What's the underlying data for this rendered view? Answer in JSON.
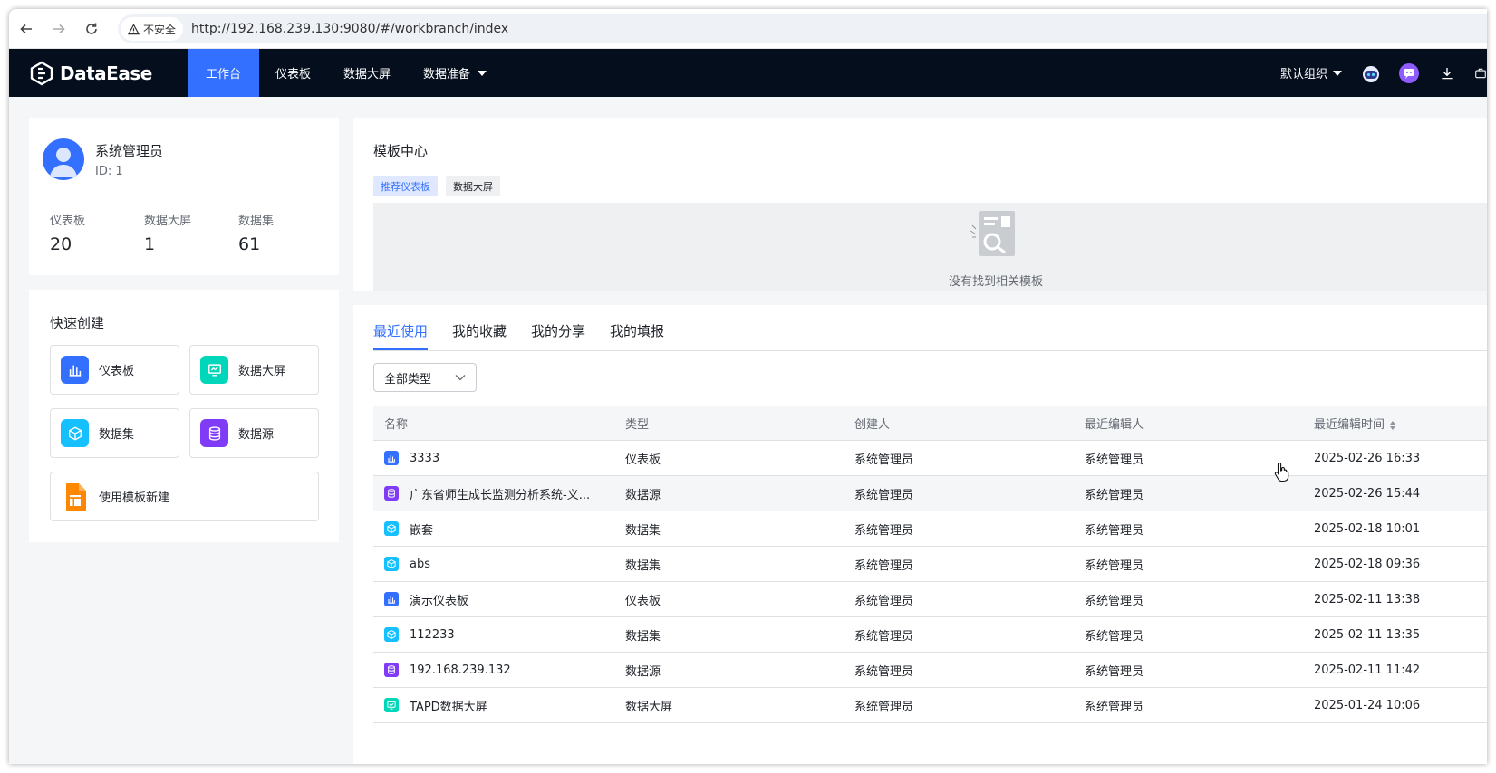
{
  "browser": {
    "security_label": "不安全",
    "url": "http://192.168.239.130:9080/#/workbranch/index"
  },
  "app": {
    "name": "DataEase",
    "nav": [
      {
        "label": "工作台",
        "active": true
      },
      {
        "label": "仪表板"
      },
      {
        "label": "数据大屏"
      },
      {
        "label": "数据准备",
        "dropdown": true
      }
    ],
    "org_label": "默认组织"
  },
  "user": {
    "name": "系统管理员",
    "id_label": "ID: 1",
    "stats": [
      {
        "label": "仪表板",
        "value": "20"
      },
      {
        "label": "数据大屏",
        "value": "1"
      },
      {
        "label": "数据集",
        "value": "61"
      }
    ]
  },
  "quick_create": {
    "title": "快速创建",
    "buttons": [
      {
        "label": "仪表板",
        "icon": "dashboard-icon",
        "color": "#3370ff"
      },
      {
        "label": "数据大屏",
        "icon": "screen-icon",
        "color": "#00d6b9"
      },
      {
        "label": "数据集",
        "icon": "dataset-icon",
        "color": "#16c0ff"
      },
      {
        "label": "数据源",
        "icon": "datasource-icon",
        "color": "#7f3bf5"
      },
      {
        "label": "使用模板新建",
        "icon": "template-icon",
        "color": "#ff8800"
      }
    ]
  },
  "template_center": {
    "title": "模板中心",
    "tags": [
      "推荐仪表板",
      "数据大屏"
    ],
    "empty_text": "没有找到相关模板"
  },
  "recent": {
    "tabs": [
      "最近使用",
      "我的收藏",
      "我的分享",
      "我的填报"
    ],
    "filter_label": "全部类型",
    "columns": [
      "名称",
      "类型",
      "创建人",
      "最近编辑人",
      "最近编辑时间"
    ],
    "rows": [
      {
        "name": "3333",
        "type": "仪表板",
        "kind": "dashboard",
        "creator": "系统管理员",
        "editor": "系统管理员",
        "time": "2025-02-26 16:33"
      },
      {
        "name": "广东省师生成长监测分析系统-义...",
        "type": "数据源",
        "kind": "datasource",
        "creator": "系统管理员",
        "editor": "系统管理员",
        "time": "2025-02-26 15:44"
      },
      {
        "name": "嵌套",
        "type": "数据集",
        "kind": "dataset",
        "creator": "系统管理员",
        "editor": "系统管理员",
        "time": "2025-02-18 10:01"
      },
      {
        "name": "abs",
        "type": "数据集",
        "kind": "dataset",
        "creator": "系统管理员",
        "editor": "系统管理员",
        "time": "2025-02-18 09:36"
      },
      {
        "name": "演示仪表板",
        "type": "仪表板",
        "kind": "dashboard",
        "creator": "系统管理员",
        "editor": "系统管理员",
        "time": "2025-02-11 13:38"
      },
      {
        "name": "112233",
        "type": "数据集",
        "kind": "dataset",
        "creator": "系统管理员",
        "editor": "系统管理员",
        "time": "2025-02-11 13:35"
      },
      {
        "name": "192.168.239.132",
        "type": "数据源",
        "kind": "datasource",
        "creator": "系统管理员",
        "editor": "系统管理员",
        "time": "2025-02-11 11:42"
      },
      {
        "name": "TAPD数据大屏",
        "type": "数据大屏",
        "kind": "screen",
        "creator": "系统管理员",
        "editor": "系统管理员",
        "time": "2025-01-24 10:06"
      }
    ]
  },
  "colors": {
    "accent": "#3370ff",
    "header_bg": "#050e1d",
    "dashboard": "#3370ff",
    "datasource": "#7f3bf5",
    "dataset": "#16c0ff",
    "screen": "#00d6b9"
  }
}
